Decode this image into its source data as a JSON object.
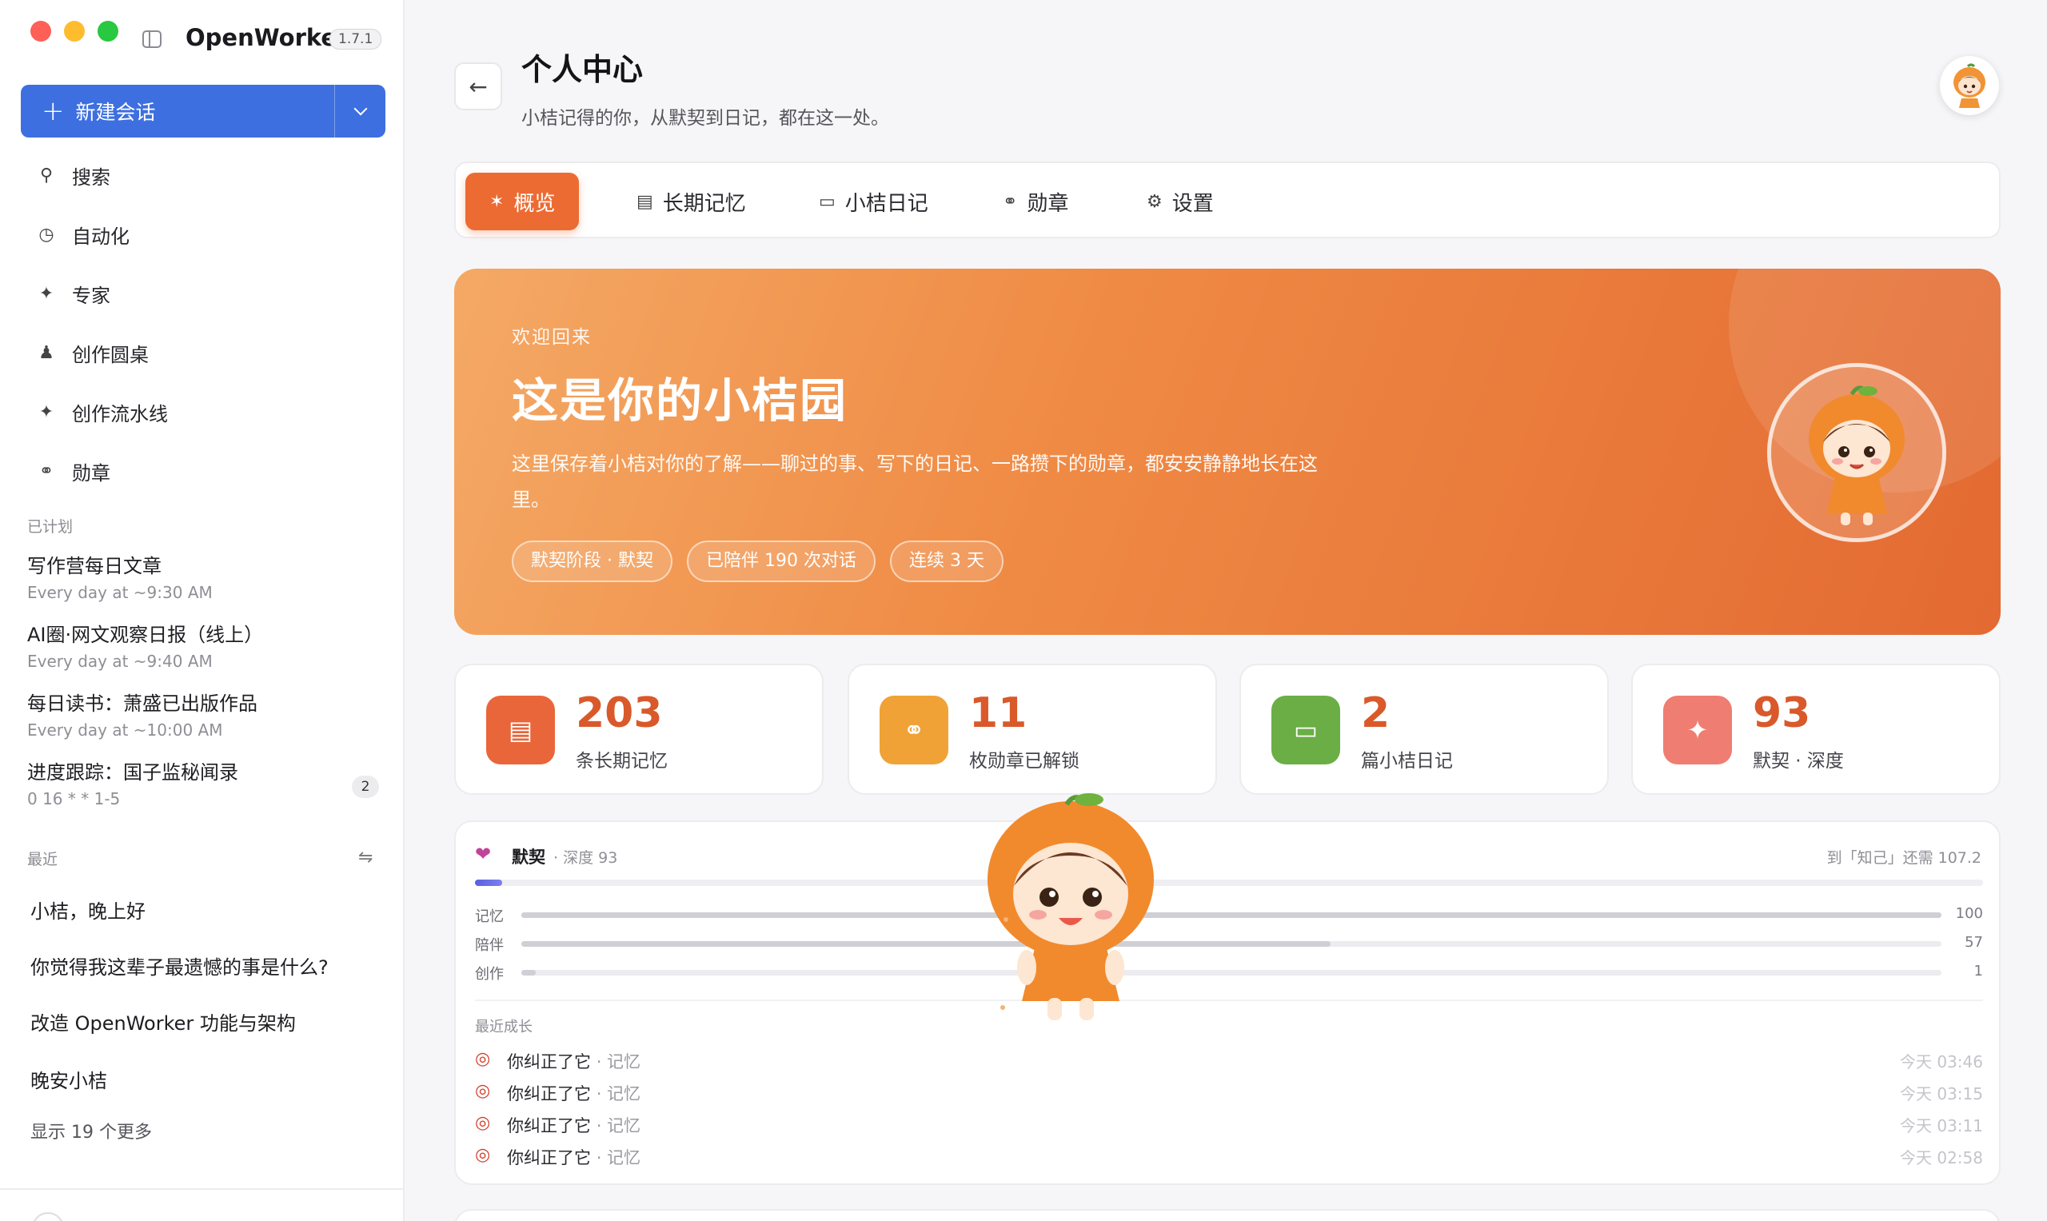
{
  "app": {
    "name": "OpenWorker",
    "version": "1.7.1"
  },
  "sidebar": {
    "new_chat": "新建会话",
    "nav": [
      {
        "label": "搜索",
        "icon": "search-icon"
      },
      {
        "label": "自动化",
        "icon": "clock-icon"
      },
      {
        "label": "专家",
        "icon": "sparkle-icon"
      },
      {
        "label": "创作圆桌",
        "icon": "users-icon"
      },
      {
        "label": "创作流水线",
        "icon": "sparkle-icon"
      },
      {
        "label": "勋章",
        "icon": "medal-icon"
      }
    ],
    "scheduled_label": "已计划",
    "scheduled": [
      {
        "title": "写作营每日文章",
        "schedule": "Every day at ~9:30 AM"
      },
      {
        "title": "AI圈·网文观察日报（线上）",
        "schedule": "Every day at ~9:40 AM"
      },
      {
        "title": "每日读书：萧盛已出版作品",
        "schedule": "Every day at ~10:00 AM"
      },
      {
        "title": "进度跟踪：国子监秘闻录",
        "schedule": "0 16 * * 1-5",
        "badge": "2"
      }
    ],
    "recent_label": "最近",
    "recent": [
      "小桔，晚上好",
      "你觉得我这辈子最遗憾的事是什么?",
      "改造 OpenWorker 功能与架构",
      "晚安小桔"
    ],
    "show_more": "显示 19 个更多"
  },
  "header": {
    "title": "个人中心",
    "subtitle": "小桔记得的你，从默契到日记，都在这一处。"
  },
  "tabs": [
    {
      "label": "概览",
      "icon": "sparkle-icon",
      "active": true
    },
    {
      "label": "长期记忆",
      "icon": "archive-icon",
      "active": false
    },
    {
      "label": "小桔日记",
      "icon": "book-icon",
      "active": false
    },
    {
      "label": "勋章",
      "icon": "medal-icon",
      "active": false
    },
    {
      "label": "设置",
      "icon": "gear-icon",
      "active": false
    }
  ],
  "hero": {
    "welcome": "欢迎回来",
    "title": "这是你的小桔园",
    "description": "这里保存着小桔对你的了解——聊过的事、写下的日记、一路攒下的勋章，都安安静静地长在这里。",
    "chips": [
      "默契阶段 · 默契",
      "已陪伴 190 次对话",
      "连续 3 天"
    ]
  },
  "stats": [
    {
      "value": "203",
      "label": "条长期记忆",
      "color": "#e9663a",
      "icon": "archive-icon"
    },
    {
      "value": "11",
      "label": "枚勋章已解锁",
      "color": "#f0a236",
      "icon": "medal-icon"
    },
    {
      "value": "2",
      "label": "篇小桔日记",
      "color": "#6aae45",
      "icon": "book-icon"
    },
    {
      "value": "93",
      "label": "默契 · 深度",
      "color": "#ef7d72",
      "icon": "sparkle-icon"
    }
  ],
  "bond": {
    "title": "默契",
    "depth": "· 深度 93",
    "next": "到「知己」还需 107.2",
    "progress": 0.018,
    "rows": [
      {
        "label": "记忆",
        "value": "100",
        "fraction": 1.0
      },
      {
        "label": "陪伴",
        "value": "57",
        "fraction": 0.57
      },
      {
        "label": "创作",
        "value": "1",
        "fraction": 0.01
      }
    ],
    "growth_label": "最近成长",
    "growth": [
      {
        "text": "你纠正了它",
        "cat": "· 记忆",
        "time": "今天 03:46"
      },
      {
        "text": "你纠正了它",
        "cat": "· 记忆",
        "time": "今天 03:15"
      },
      {
        "text": "你纠正了它",
        "cat": "· 记忆",
        "time": "今天 03:11"
      },
      {
        "text": "你纠正了它",
        "cat": "· 记忆",
        "time": "今天 02:58"
      }
    ]
  }
}
